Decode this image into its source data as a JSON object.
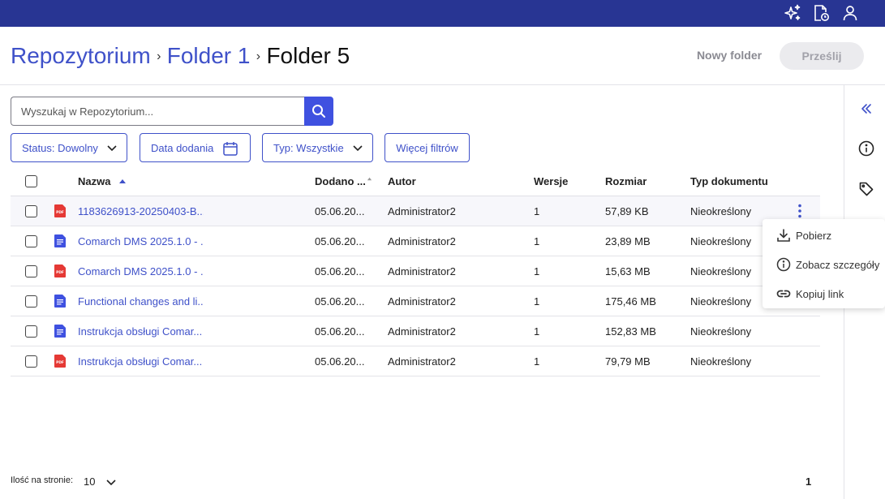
{
  "topbar": {
    "icons": [
      "sparkles-icon",
      "document-clock-icon",
      "user-icon"
    ]
  },
  "breadcrumb": {
    "items": [
      "Repozytorium",
      "Folder 1"
    ],
    "current": "Folder 5"
  },
  "actions": {
    "new_folder": "Nowy folder",
    "upload": "Prześlij"
  },
  "search": {
    "placeholder": "Wyszukaj w Repozytorium..."
  },
  "filters": {
    "status": "Status: Dowolny",
    "date": "Data dodania",
    "type": "Typ: Wszystkie",
    "more": "Więcej filtrów"
  },
  "table": {
    "columns": {
      "name": "Nazwa",
      "added": "Dodano ...",
      "author": "Autor",
      "versions": "Wersje",
      "size": "Rozmiar",
      "doctype": "Typ dokumentu"
    },
    "rows": [
      {
        "icon": "pdf-file-icon",
        "name": "1183626913-20250403-B...",
        "added": "05.06.20...",
        "author": "Administrator2",
        "versions": "1",
        "size": "57,89 KB",
        "doctype": "Nieokreślony"
      },
      {
        "icon": "doc-file-icon",
        "name": "Comarch DMS 2025.1.0 - ...",
        "added": "05.06.20...",
        "author": "Administrator2",
        "versions": "1",
        "size": "23,89 MB",
        "doctype": "Nieokreślony"
      },
      {
        "icon": "pdf-file-icon",
        "name": "Comarch DMS 2025.1.0 - ...",
        "added": "05.06.20...",
        "author": "Administrator2",
        "versions": "1",
        "size": "15,63 MB",
        "doctype": "Nieokreślony"
      },
      {
        "icon": "doc-file-icon",
        "name": "Functional changes and li...",
        "added": "05.06.20...",
        "author": "Administrator2",
        "versions": "1",
        "size": "175,46 MB",
        "doctype": "Nieokreślony"
      },
      {
        "icon": "doc-file-icon",
        "name": "Instrukcja obsługi Comar...",
        "added": "05.06.20...",
        "author": "Administrator2",
        "versions": "1",
        "size": "152,83 MB",
        "doctype": "Nieokreślony"
      },
      {
        "icon": "pdf-file-icon",
        "name": "Instrukcja obsługi Comar...",
        "added": "05.06.20...",
        "author": "Administrator2",
        "versions": "1",
        "size": "79,79 MB",
        "doctype": "Nieokreślony"
      }
    ]
  },
  "context_menu": {
    "items": [
      "Pobierz",
      "Zobacz szczegóły",
      "Kopiuj link"
    ]
  },
  "footer": {
    "page_size_label": "Ilość na stronie:",
    "page_size": "10",
    "page": "1"
  },
  "pdf_badge": "PDF",
  "colors": {
    "topbar": "#283593",
    "accent": "#3f51c9",
    "search_button": "#3f51e0",
    "pdf": "#e53935",
    "doc": "#3f51e0"
  }
}
